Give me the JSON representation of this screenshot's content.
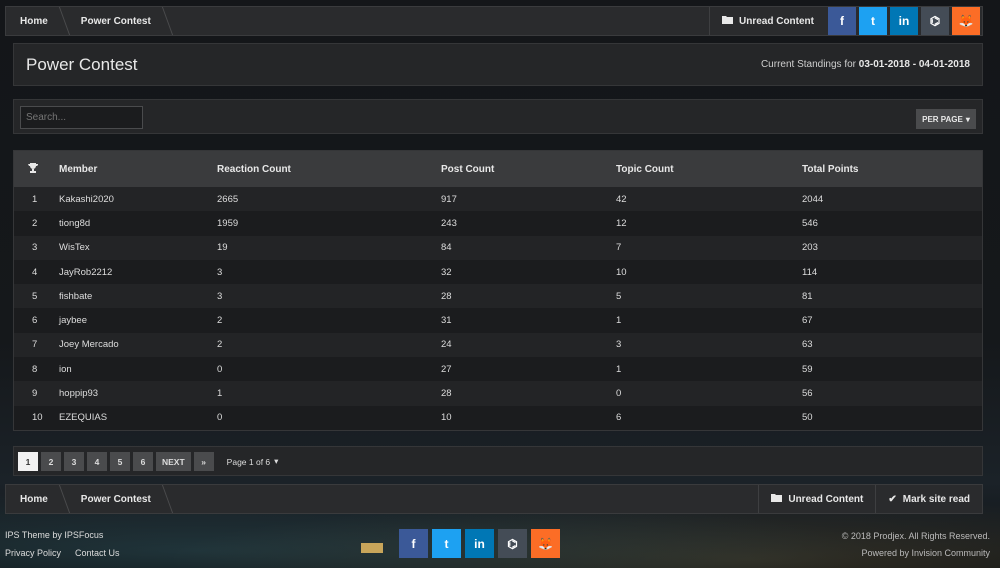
{
  "breadcrumb": {
    "home": "Home",
    "current": "Power Contest"
  },
  "header": {
    "unread_label": "Unread Content",
    "social": [
      {
        "name": "facebook",
        "glyph": "f"
      },
      {
        "name": "twitter",
        "glyph": "t"
      },
      {
        "name": "linkedin",
        "glyph": "in"
      },
      {
        "name": "github",
        "glyph": "⌬"
      },
      {
        "name": "gitlab",
        "glyph": "🦊"
      }
    ]
  },
  "title": {
    "heading": "Power Contest",
    "standings_prefix": "Current Standings for",
    "standings_range": "03-01-2018 - 04-01-2018"
  },
  "controls": {
    "search_placeholder": "Search...",
    "per_page_label": "PER PAGE"
  },
  "table": {
    "columns": [
      "Member",
      "Reaction Count",
      "Post Count",
      "Topic Count",
      "Total Points"
    ],
    "rows": [
      {
        "rank": "1",
        "member": "Kakashi2020",
        "reactions": "2665",
        "posts": "917",
        "topics": "42",
        "points": "2044"
      },
      {
        "rank": "2",
        "member": "tiong8d",
        "reactions": "1959",
        "posts": "243",
        "topics": "12",
        "points": "546"
      },
      {
        "rank": "3",
        "member": "WisTex",
        "reactions": "19",
        "posts": "84",
        "topics": "7",
        "points": "203"
      },
      {
        "rank": "4",
        "member": "JayRob2212",
        "reactions": "3",
        "posts": "32",
        "topics": "10",
        "points": "114"
      },
      {
        "rank": "5",
        "member": "fishbate",
        "reactions": "3",
        "posts": "28",
        "topics": "5",
        "points": "81"
      },
      {
        "rank": "6",
        "member": "jaybee",
        "reactions": "2",
        "posts": "31",
        "topics": "1",
        "points": "67"
      },
      {
        "rank": "7",
        "member": "Joey Mercado",
        "reactions": "2",
        "posts": "24",
        "topics": "3",
        "points": "63"
      },
      {
        "rank": "8",
        "member": "ion",
        "reactions": "0",
        "posts": "27",
        "topics": "1",
        "points": "59"
      },
      {
        "rank": "9",
        "member": "hoppip93",
        "reactions": "1",
        "posts": "28",
        "topics": "0",
        "points": "56"
      },
      {
        "rank": "10",
        "member": "EZEQUIAS",
        "reactions": "0",
        "posts": "10",
        "topics": "6",
        "points": "50"
      }
    ]
  },
  "pagination": {
    "pages": [
      "1",
      "2",
      "3",
      "4",
      "5",
      "6"
    ],
    "active": "1",
    "next": "NEXT",
    "last": "»",
    "page_of": "Page 1 of 6"
  },
  "bottom_bar": {
    "home": "Home",
    "current": "Power Contest",
    "unread_label": "Unread Content",
    "mark_read_label": "Mark site read"
  },
  "footer": {
    "theme_credit": "IPS Theme by IPSFocus",
    "privacy": "Privacy Policy",
    "contact": "Contact Us",
    "copyright": "© 2018 Prodjex. All Rights Reserved.",
    "powered": "Powered by Invision Community"
  },
  "colors": {
    "facebook": "#3b5998",
    "twitter": "#1da1f2",
    "linkedin": "#0077b5",
    "github": "#444c56",
    "gitlab": "#fc6d26"
  }
}
